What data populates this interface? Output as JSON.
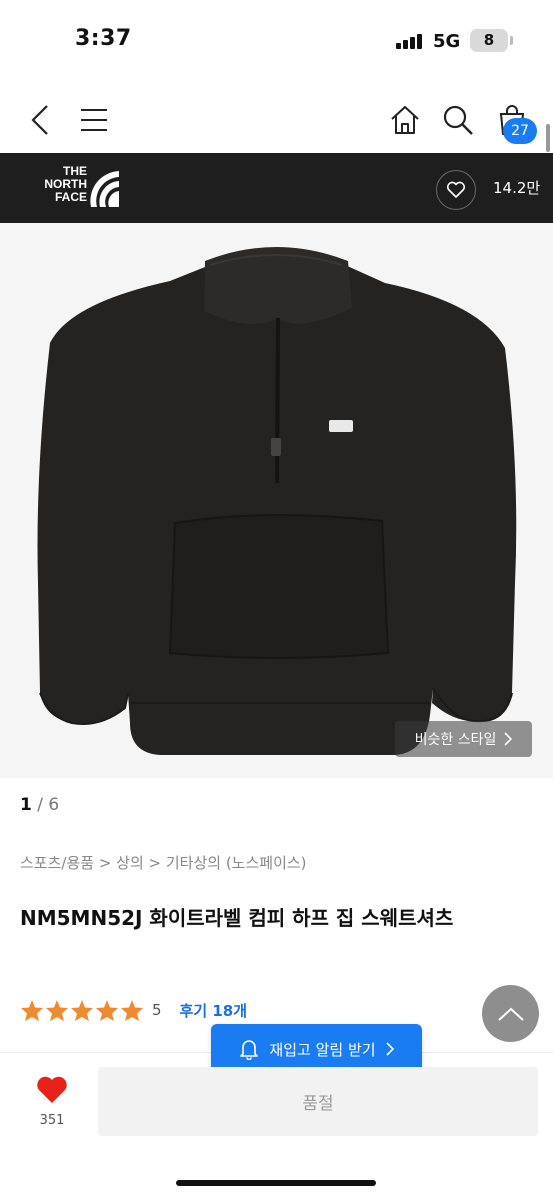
{
  "status_bar": {
    "time": "3:37",
    "network": "5G",
    "battery": "8"
  },
  "header": {
    "icons": [
      "chevron-left-icon",
      "menu-icon",
      "home-icon",
      "search-icon",
      "cart-icon"
    ],
    "cart_count": "27"
  },
  "brand": {
    "logo_lines": [
      "THE",
      "NORTH",
      "FACE"
    ],
    "like_count": "14.2만"
  },
  "gallery": {
    "similar_style": "비슷한 스타일",
    "current": "1",
    "separator": " / ",
    "total": "6"
  },
  "product": {
    "breadcrumb": "스포츠/용품 > 상의 > 기타상의 (노스페이스)",
    "title": "NM5MN52J 화이트라벨 컴피 하프 집 스웨트셔츠",
    "rating": "5",
    "review_link": "후기 18개"
  },
  "actions": {
    "restock_label": "재입고 알림 받기",
    "wish_count": "351",
    "soldout_label": "품절"
  },
  "colors": {
    "accent": "#1a7cf3",
    "star": "#f08a2c",
    "heart": "#e8211a",
    "brand_bar": "#1e1e1e"
  }
}
